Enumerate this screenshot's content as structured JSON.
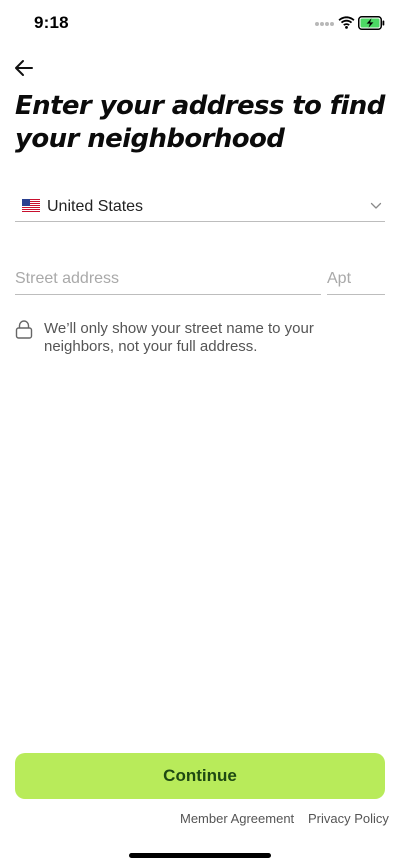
{
  "status_bar": {
    "time": "9:18"
  },
  "header": {
    "back_icon": "arrow-left-icon",
    "title": "Enter your address to find your neighborhood"
  },
  "form": {
    "country": {
      "flag": "us-flag-icon",
      "value": "United States"
    },
    "street": {
      "placeholder": "Street address",
      "value": ""
    },
    "apt": {
      "placeholder": "Apt",
      "value": ""
    },
    "privacy_note": "We’ll only show your street name to your neighbors, not your full address."
  },
  "actions": {
    "continue_label": "Continue"
  },
  "footer": {
    "member_agreement": "Member Agreement",
    "privacy_policy": "Privacy Policy"
  },
  "colors": {
    "accent": "#b8eb5a",
    "accent_text": "#1e4a12",
    "battery": "#4cd964"
  }
}
